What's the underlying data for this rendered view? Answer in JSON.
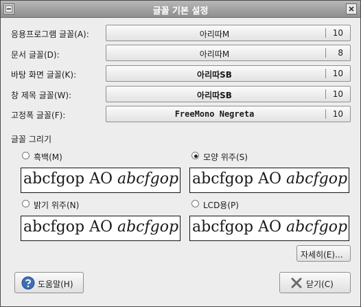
{
  "window": {
    "title": "글꼴 기본 설정"
  },
  "fonts": [
    {
      "label": "응용프로그램 글꼴(A):",
      "mnemonic": "A",
      "name": "아리따M",
      "size": "10"
    },
    {
      "label": "문서 글꼴(D):",
      "mnemonic": "D",
      "name": "아리따M",
      "size": "8"
    },
    {
      "label": "바탕 화면 글꼴(K):",
      "mnemonic": "K",
      "name": "아리따SB",
      "size": "10"
    },
    {
      "label": "창 제목 글꼴(W):",
      "mnemonic": "W",
      "name": "아리따SB",
      "size": "10"
    },
    {
      "label": "고정폭 글꼴(F):",
      "mnemonic": "F",
      "name": "FreeMono Negreta",
      "size": "10"
    }
  ],
  "rendering": {
    "title": "글꼴 그리기",
    "options": [
      {
        "label": "흑백(M)",
        "selected": false,
        "preview_regular": "abcfgop AO ",
        "preview_italic": "abcfgop"
      },
      {
        "label": "모양 위주(S)",
        "selected": true,
        "preview_regular": "abcfgop AO ",
        "preview_italic": "abcfgop"
      },
      {
        "label": "밝기 위주(N)",
        "selected": false,
        "preview_regular": "abcfgop AO ",
        "preview_italic": "abcfgop"
      },
      {
        "label": "LCD용(P)",
        "selected": false,
        "preview_regular": "abcfgop AO ",
        "preview_italic": "abcfgop"
      }
    ]
  },
  "buttons": {
    "details": "자세히(E)...",
    "help": "도움말(H)",
    "close": "닫기(C)"
  },
  "icons": {
    "window_menu": "window-menu-icon",
    "window_close": "window-close-icon",
    "help": "help-icon",
    "close": "close-x-icon"
  },
  "colors": {
    "help_icon": "#3d6fb5",
    "close_icon": "#6a6a6a"
  }
}
